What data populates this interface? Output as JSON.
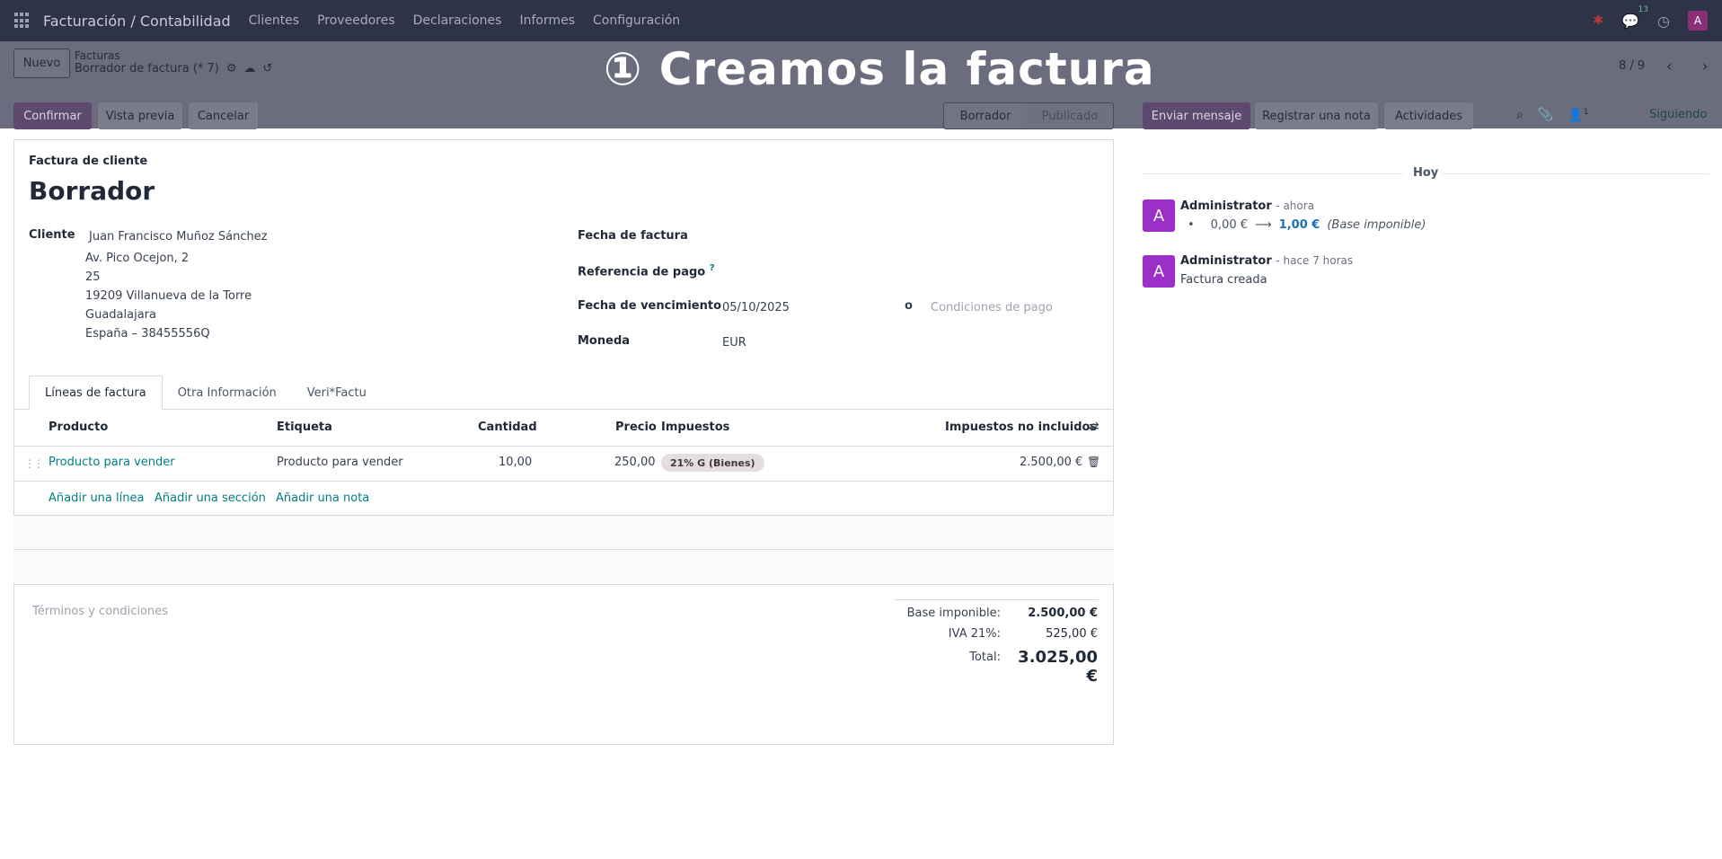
{
  "navbar": {
    "app_title": "Facturación / Contabilidad",
    "menu": [
      "Clientes",
      "Proveedores",
      "Declaraciones",
      "Informes",
      "Configuración"
    ],
    "chat_count": "13",
    "avatar_letter": "A"
  },
  "overlay": {
    "title": "①  Creamos la factura"
  },
  "control_panel": {
    "new_button": "Nuevo",
    "breadcrumb_parent": "Facturas",
    "breadcrumb_current": "Borrador de factura (* 7)",
    "pager": "8 / 9"
  },
  "actions": {
    "confirm": "Confirmar",
    "preview": "Vista previa",
    "cancel": "Cancelar"
  },
  "statusbar": {
    "active": "Borrador",
    "next": "Publicado"
  },
  "form": {
    "type_label": "Factura de cliente",
    "title": "Borrador",
    "customer_label": "Cliente",
    "customer_name": "Juan Francisco Muñoz Sánchez",
    "address": [
      "Av. Pico Ocejon, 2",
      "25",
      "19209 Villanueva de la Torre",
      "Guadalajara",
      "España – 38455556Q"
    ],
    "invoice_date_label": "Fecha de factura",
    "payment_ref_label": "Referencia de pago",
    "payment_ref_help": "?",
    "due_date_label": "Fecha de vencimiento",
    "due_date_value": "05/10/2025",
    "or_text": "o",
    "payment_terms_placeholder": "Condiciones de pago",
    "currency_label": "Moneda",
    "currency_value": "EUR"
  },
  "tabs": [
    "Líneas de factura",
    "Otra Información",
    "Veri*Factu"
  ],
  "lines_table": {
    "headers": {
      "product": "Producto",
      "label": "Etiqueta",
      "quantity": "Cantidad",
      "price": "Precio",
      "taxes": "Impuestos",
      "subtotal": "Impuestos no incluidos"
    },
    "rows": [
      {
        "product": "Producto para vender",
        "label": "Producto para vender",
        "quantity": "10,00",
        "price": "250,00",
        "tax": "21% G (Bienes)",
        "subtotal": "2.500,00 €"
      }
    ],
    "add_line": "Añadir una línea",
    "add_section": "Añadir una sección",
    "add_note": "Añadir una nota"
  },
  "terms_placeholder": "Términos y condiciones",
  "totals": {
    "base_label": "Base imponible:",
    "base_value": "2.500,00 €",
    "iva_label": "IVA 21%:",
    "iva_value": "525,00 €",
    "total_label": "Total:",
    "total_value": "3.025,00 €"
  },
  "chatter": {
    "send_message": "Enviar mensaje",
    "log_note": "Registrar una nota",
    "activities": "Actividades",
    "followers_count": "1",
    "following": "Siguiendo",
    "today": "Hoy",
    "messages": [
      {
        "avatar": "A",
        "author": "Administrator",
        "time": "- ahora",
        "old_value": "0,00 €",
        "arrow": "⟶",
        "new_value": "1,00 €",
        "field": "(Base imponible)"
      },
      {
        "avatar": "A",
        "author": "Administrator",
        "time": "- hace 7 horas",
        "text": "Factura creada"
      }
    ]
  }
}
